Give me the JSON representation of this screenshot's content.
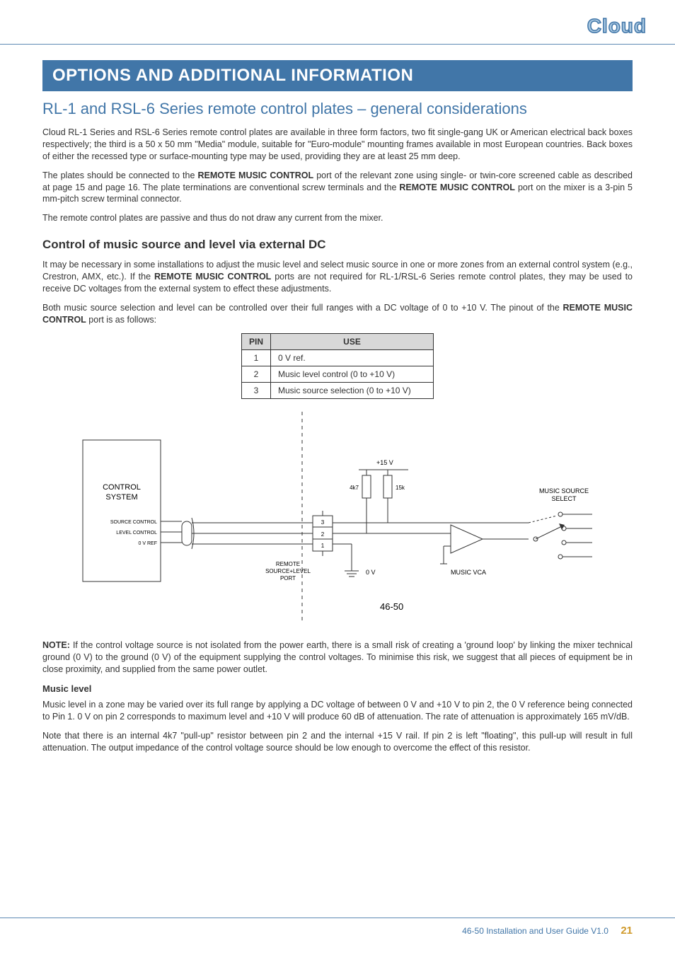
{
  "logo": "Cloud",
  "band_title": "OPTIONS AND ADDITIONAL INFORMATION",
  "h2": "RL-1 and RSL-6 Series remote control plates – general considerations",
  "p1": "Cloud RL-1 Series and RSL-6 Series remote control plates are available in three form factors, two fit single-gang UK or American electrical back boxes respectively; the third is a 50 x 50 mm \"Media\" module, suitable for \"Euro-module\" mounting frames available in most European countries. Back boxes of either the recessed type or surface-mounting type may be used, providing they are at least 25 mm deep.",
  "p2a": "The plates should be connected to the ",
  "p2_bold1": "REMOTE MUSIC CONTROL",
  "p2b": " port of the relevant zone using single- or twin-core screened cable as described at page 15 and page 16. The plate terminations are conventional screw terminals and the ",
  "p2_bold2": "REMOTE MUSIC CONTROL",
  "p2c": " port on the mixer is a 3-pin 5 mm-pitch screw terminal connector.",
  "p3": "The remote control plates are passive and thus do not draw any current from the mixer.",
  "h3": "Control of music source and level via external DC",
  "p4a": "It may be necessary in some installations to adjust the music level and select music source in one or more zones from an external control system (e.g., Crestron, AMX, etc.). If the ",
  "p4_bold": "REMOTE MUSIC CONTROL",
  "p4b": " ports are not required for RL-1/RSL-6 Series remote control plates, they may be used to receive DC voltages from the external system to effect these adjustments.",
  "p5a": "Both music source selection and level can be controlled over their full ranges with a DC voltage of 0 to +10 V. The pinout of the ",
  "p5_bold": "REMOTE MUSIC CONTROL",
  "p5b": " port is as follows:",
  "table": {
    "head_pin": "PIN",
    "head_use": "USE",
    "rows": [
      {
        "pin": "1",
        "use": "0 V ref."
      },
      {
        "pin": "2",
        "use": "Music level control (0 to +10 V)"
      },
      {
        "pin": "3",
        "use": "Music source selection (0 to +10 V)"
      }
    ]
  },
  "diagram": {
    "control_system": "CONTROL\nSYSTEM",
    "source_control": "SOURCE CONTROL",
    "level_control": "LEVEL CONTROL",
    "vref": "0 V REF",
    "pin3": "3",
    "pin2": "2",
    "pin1": "1",
    "port_label": "REMOTE\nSOURCE+LEVEL\nPORT",
    "v15": "+15 V",
    "r4k7": "4k7",
    "r15k": "15k",
    "zero_v": "0 V",
    "music_vca": "MUSIC VCA",
    "music_source_select": "MUSIC SOURCE\nSELECT",
    "model": "46-50"
  },
  "note_bold": "NOTE:",
  "note_body": " If the control voltage source is not isolated from the power earth, there is a small risk of creating a 'ground loop' by linking the mixer technical ground (0 V) to the ground (0 V) of the equipment supplying the control voltages. To minimise this risk, we suggest that all pieces of equipment be in close proximity, and supplied from the same power outlet.",
  "h4": "Music level",
  "p6": "Music level in a zone may be varied over its full range by applying a DC voltage of between 0 V and +10 V to pin 2, the 0 V reference being connected to Pin 1. 0 V on pin 2 corresponds to maximum level and +10 V will produce 60 dB of attenuation. The rate of attenuation is approximately 165 mV/dB.",
  "p7": "Note that there is an internal 4k7 \"pull-up\" resistor between pin 2 and the internal +15 V rail. If pin 2 is left \"floating\", this pull-up will result in full attenuation. The output impedance of the control voltage source should be low enough to overcome the effect of this resistor.",
  "footer": {
    "text": "46-50 Installation and User Guide V1.0",
    "page": "21"
  }
}
